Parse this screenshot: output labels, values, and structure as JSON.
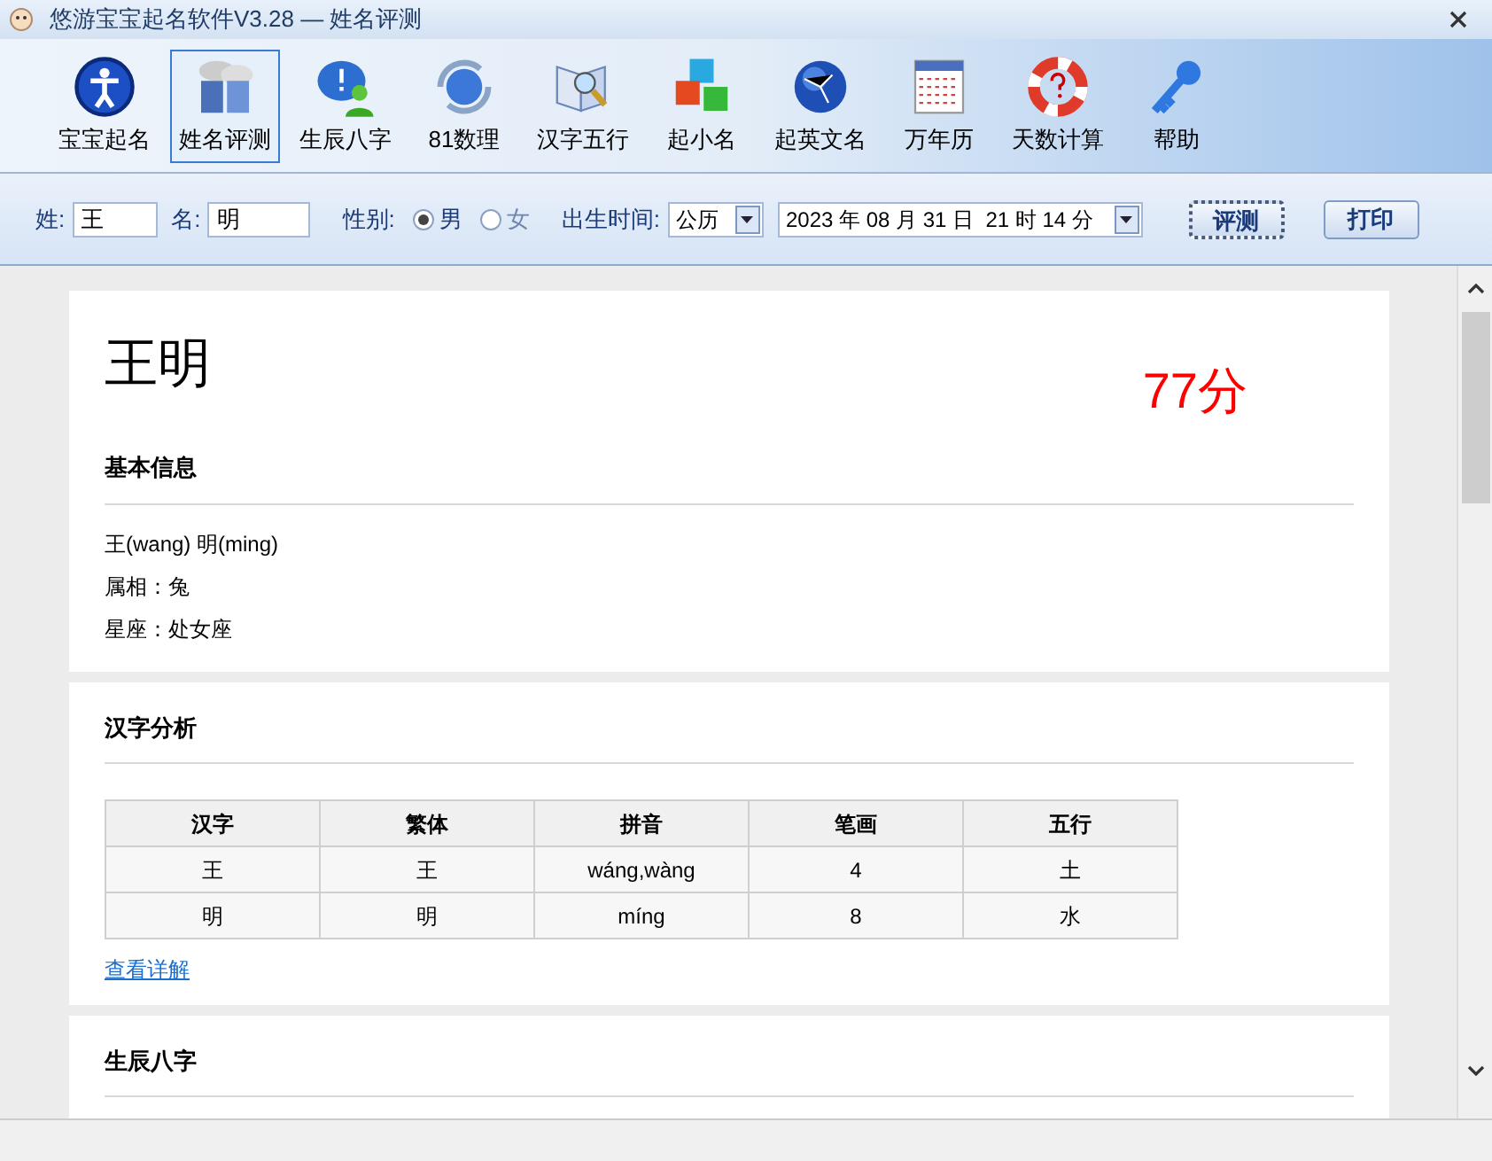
{
  "window": {
    "title": "悠游宝宝起名软件V3.28  —  姓名评测"
  },
  "toolbar": [
    {
      "label": "宝宝起名",
      "selected": false
    },
    {
      "label": "姓名评测",
      "selected": true
    },
    {
      "label": "生辰八字",
      "selected": false
    },
    {
      "label": "81数理",
      "selected": false
    },
    {
      "label": "汉字五行",
      "selected": false
    },
    {
      "label": "起小名",
      "selected": false
    },
    {
      "label": "起英文名",
      "selected": false
    },
    {
      "label": "万年历",
      "selected": false
    },
    {
      "label": "天数计算",
      "selected": false
    },
    {
      "label": "帮助",
      "selected": false
    }
  ],
  "form": {
    "surname_label": "姓:",
    "surname": "王",
    "given_label": "名:",
    "given": "明",
    "gender_label": "性别:",
    "gender": [
      {
        "label": "男",
        "selected": true
      },
      {
        "label": "女",
        "selected": false
      }
    ],
    "birth_label": "出生时间:",
    "calendar": "公历",
    "datetime": "2023 年 08 月 31 日  21 时 14 分",
    "buttons": [
      "评测",
      "打印"
    ]
  },
  "report": {
    "name": "王明",
    "score": "77分",
    "basic": {
      "heading": "基本信息",
      "lines": [
        "王(wang) 明(ming)",
        "属相：兔",
        "星座：处女座"
      ]
    },
    "analysis": {
      "heading": "汉字分析",
      "columns": [
        "汉字",
        "繁体",
        "拼音",
        "笔画",
        "五行"
      ],
      "rows": [
        [
          "王",
          "王",
          "wáng,wàng",
          "4",
          "土"
        ],
        [
          "明",
          "明",
          "míng",
          "8",
          "水"
        ]
      ],
      "link": "查看详解"
    },
    "bazi": {
      "heading": "生辰八字"
    }
  }
}
